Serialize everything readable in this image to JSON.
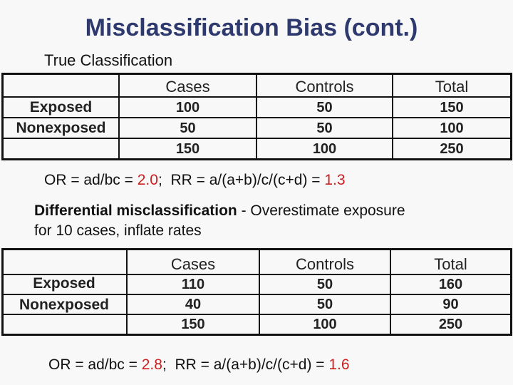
{
  "slide": {
    "title": "Misclassification Bias (cont.)",
    "subtitle": "True Classification",
    "accent_color": "#2e3a6e",
    "highlight_color": "#cc1f1f"
  },
  "table_true": {
    "headers": [
      "",
      "Cases",
      "Controls",
      "Total"
    ],
    "rows": [
      {
        "label": "Exposed",
        "cases": "100",
        "controls": "50",
        "total": "150"
      },
      {
        "label": "Nonexposed",
        "cases": "50",
        "controls": "50",
        "total": "100"
      },
      {
        "label": "",
        "cases": "150",
        "controls": "100",
        "total": "250"
      }
    ]
  },
  "formula_true": {
    "or_prefix": "OR = ad/bc = ",
    "or_value": "2.0",
    "rr_prefix": ";  RR = a/(a+b)/c/(c+d) = ",
    "rr_value": "1.3"
  },
  "differential": {
    "bold_text": "Differential misclassification",
    "rest_line1": " - Overestimate exposure",
    "line2": "for 10 cases, inflate rates"
  },
  "table_diff": {
    "headers": [
      "",
      "Cases",
      "Controls",
      "Total"
    ],
    "rows": [
      {
        "label": "Exposed",
        "cases": "110",
        "controls": "50",
        "total": "160"
      },
      {
        "label": "Nonexposed",
        "cases": "40",
        "controls": "50",
        "total": "90"
      },
      {
        "label": "",
        "cases": "150",
        "controls": "100",
        "total": "250"
      }
    ]
  },
  "formula_diff": {
    "or_prefix": "OR = ad/bc = ",
    "or_value": "2.8",
    "rr_prefix": ";  RR = a/(a+b)/c/(c+d) = ",
    "rr_value": "1.6"
  }
}
